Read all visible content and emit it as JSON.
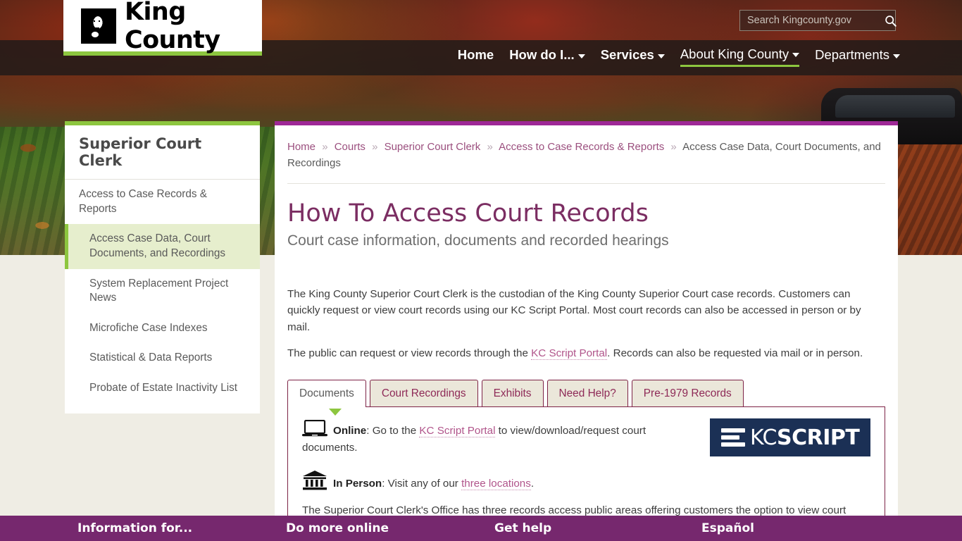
{
  "header": {
    "logo_text": "King County",
    "logo_icon": "mlk-silhouette-icon",
    "search": {
      "placeholder": "Search Kingcounty.gov",
      "value": "",
      "icon": "search-icon"
    },
    "nav": [
      {
        "label": "Home",
        "has_caret": false,
        "bold": true,
        "underlined": false
      },
      {
        "label": "How do I...",
        "has_caret": true,
        "bold": true,
        "underlined": false
      },
      {
        "label": "Services",
        "has_caret": true,
        "bold": true,
        "underlined": false
      },
      {
        "label": "About King County",
        "has_caret": true,
        "bold": false,
        "underlined": true
      },
      {
        "label": "Departments",
        "has_caret": true,
        "bold": false,
        "underlined": false
      }
    ]
  },
  "sidebar": {
    "title": "Superior Court Clerk",
    "items": [
      {
        "label": "Access to Case Records & Reports",
        "active": false,
        "sub": false
      },
      {
        "label": "Access Case Data, Court Documents, and Recordings",
        "active": true,
        "sub": true
      },
      {
        "label": "System Replacement Project News",
        "active": false,
        "sub": true
      },
      {
        "label": "Microfiche Case Indexes",
        "active": false,
        "sub": true
      },
      {
        "label": "Statistical & Data Reports",
        "active": false,
        "sub": true
      },
      {
        "label": "Probate of Estate Inactivity List",
        "active": false,
        "sub": true
      }
    ]
  },
  "breadcrumb": {
    "links": [
      "Home",
      "Courts",
      "Superior Court Clerk",
      "Access to Case Records & Reports"
    ],
    "separator": "»",
    "current": "Access Case Data, Court Documents, and Recordings"
  },
  "main": {
    "title": "How To Access Court Records",
    "subtitle": "Court case information, documents and recorded hearings",
    "paragraph1": "The King County Superior Court Clerk is the custodian of the King County Superior Court case records. Customers can quickly request or view court records using our KC Script Portal. Most court records can also be accessed in person or by mail.",
    "paragraph2_pre": "The public can request or view records through the ",
    "paragraph2_link": "KC Script Portal",
    "paragraph2_post": ". Records can also be requested via mail or in person.",
    "tabs": [
      {
        "label": "Documents",
        "active": true
      },
      {
        "label": "Court Recordings",
        "active": false
      },
      {
        "label": "Exhibits",
        "active": false
      },
      {
        "label": "Need Help?",
        "active": false
      },
      {
        "label": "Pre-1979 Records",
        "active": false
      }
    ],
    "panel": {
      "online_icon": "laptop-icon",
      "online_label": "Online",
      "online_pre": ": Go to the ",
      "online_link": "KC Script Portal",
      "online_post": " to view/download/request court documents.",
      "inperson_icon": "bank-building-icon",
      "inperson_label": "In Person",
      "inperson_pre": ": Visit any of our ",
      "inperson_link": "three locations",
      "inperson_post": ".",
      "body": "The Superior Court Clerk's Office has three records access public areas offering customers the option to view court documents for free, during business hours. You can also request and purchase records at one of these locations as",
      "logo": {
        "part1": "KC",
        "part2": "SCRIPT",
        "bars_icon": "kcscript-bars-icon"
      }
    }
  },
  "footer": {
    "links": [
      "Information for...",
      "Do more online",
      "Get help",
      "Español"
    ]
  },
  "colors": {
    "green": "#8dc63f",
    "purple_title": "#7b2d62",
    "footer_purple": "#76286e",
    "tab_border": "#7d2346",
    "link_pink": "#b1558b",
    "kcscript_navy": "#1b3055"
  }
}
